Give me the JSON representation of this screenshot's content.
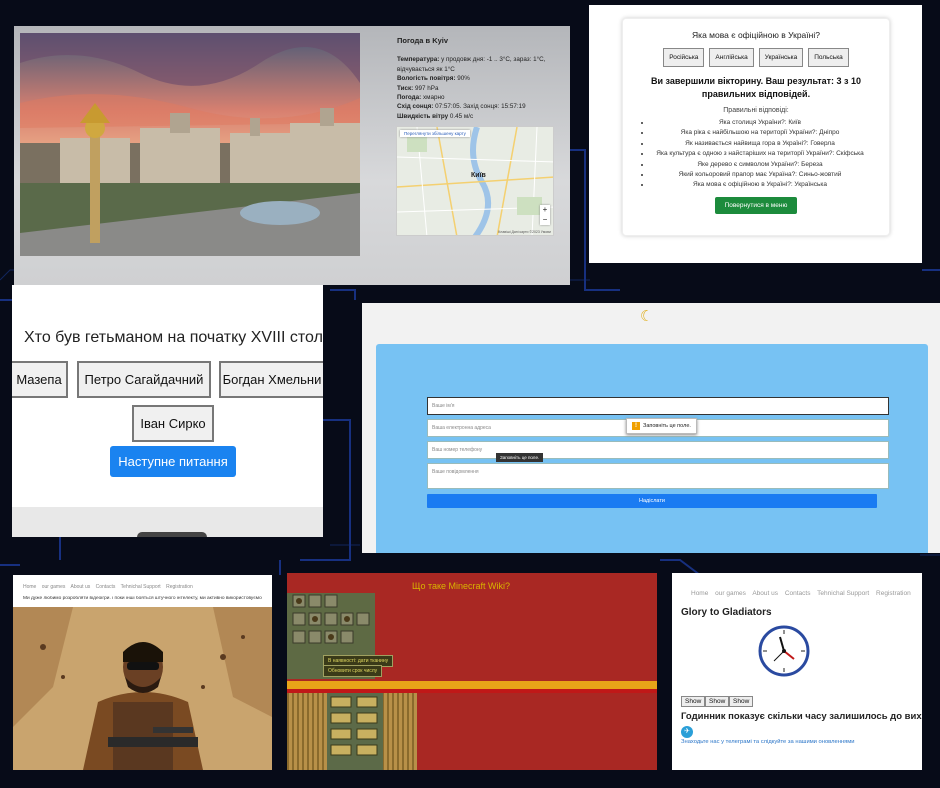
{
  "weather": {
    "title": "Погода в Kyiv",
    "lines": [
      {
        "k": "Температура:",
        "v": " у продовж дня: -1 .. 3°C, зараз: 1°C,"
      },
      {
        "k": "",
        "v": "відчувається як 1°C"
      },
      {
        "k": "Вологість повітря:",
        "v": " 90%"
      },
      {
        "k": "Тиск:",
        "v": " 997 hPa"
      },
      {
        "k": "Погода:",
        "v": " хмарно"
      },
      {
        "k": "Схід сонця:",
        "v": " 07:57:05. Захід сонця: 15:57:19"
      },
      {
        "k": "Швидкість вітру",
        "v": " 0.45 м/с"
      }
    ],
    "map_link": "Переглянути збільшену карту",
    "map_city": "Київ",
    "map_zoom_in": "+",
    "map_zoom_out": "−",
    "map_footer": "Клавіші  Дані карти ©2023  Умови"
  },
  "quiz": {
    "question": "Яка мова є офіційною в Україні?",
    "options": [
      "Російська",
      "Англійська",
      "Українська",
      "Польська"
    ],
    "result": "Ви завершили вікторину. Ваш результат: 3 з 10 правильних відповідей.",
    "correct_title": "Правильні відповіді:",
    "answers": [
      "Яка столиця України?: Київ",
      "Яка ріка є найбільшою на території України?: Дніпро",
      "Як називається найвища гора в Україні?: Говерла",
      "Яка культура є одною з найстаріших на території України?: Скіфська",
      "Яке дерево є символом України?: Береза",
      "Який кольоровий прапор має Україна?: Синьо-жовтий",
      "Яка мова є офіційною в Україні?: Українська"
    ],
    "back_button": "Повернутися в меню"
  },
  "hetman": {
    "question": "Хто був гетьманом на початку XVIII століття?",
    "options": [
      "Мазепа",
      "Петро Сагайдачний",
      "Богдан Хмельни",
      "Іван Сирко"
    ],
    "next_button": "Наступне питання"
  },
  "form": {
    "moon_icon": "☾",
    "name_placeholder": "Ваше ім'я",
    "email_placeholder": "Ваша електронна адреса",
    "phone_placeholder": "Ваш номер телефону",
    "message_placeholder": "Ваше повідомлення",
    "submit": "Надіслати",
    "tooltip_required": "Заповніть це поле.",
    "tooltip_small": "Заповніть це поле."
  },
  "soldier": {
    "nav": [
      "Home",
      "our games",
      "About us",
      "Contacts",
      "Tehnichal Support",
      "Registration"
    ],
    "text": "Ми дуже любимо розробляти відеоігри. і поки інші бояться штучного інтелекту, ми активно використовуємо"
  },
  "game": {
    "title": "Що таке Minecraft Wiki?",
    "tooltip1": "В наявності: дати тканину",
    "tooltip2": "Обновити срок числу"
  },
  "gladiators": {
    "nav": [
      "Home",
      "our games",
      "About us",
      "Contacts",
      "Tehnichal Support",
      "Registration"
    ],
    "title": "Glory to Gladiators",
    "show_buttons": [
      "Show",
      "Show",
      "Show"
    ],
    "clock_text": "Годинник показує скільки часу залишилось до вих",
    "telegram_link": "Знаходьте нас у телеграмі та слідкуйте за нашими оновленнями"
  }
}
